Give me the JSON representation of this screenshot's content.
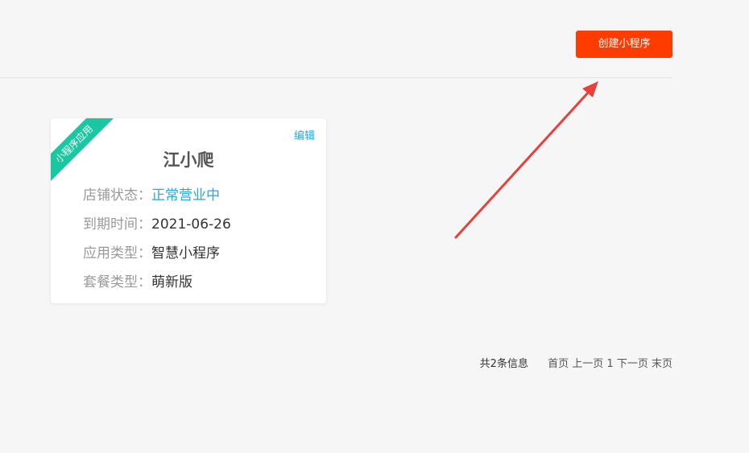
{
  "header": {
    "create_button": "创建小程序"
  },
  "card": {
    "ribbon": "小程序应用",
    "edit_label": "编辑",
    "title": "江小爬",
    "rows": [
      {
        "label": "店铺状态：",
        "value": "正常营业中"
      },
      {
        "label": "到期时间：",
        "value": "2021-06-26"
      },
      {
        "label": "应用类型：",
        "value": "智慧小程序"
      },
      {
        "label": "套餐类型：",
        "value": "萌新版"
      }
    ]
  },
  "pagination": {
    "total": "共2条信息",
    "first": "首页",
    "prev": "上一页",
    "current": "1",
    "next": "下一页",
    "last": "末页"
  },
  "colors": {
    "accent": "#ff3c00",
    "ribbon": "#19c8a0",
    "link": "#2aa6d8",
    "arrow": "#e8403a"
  }
}
